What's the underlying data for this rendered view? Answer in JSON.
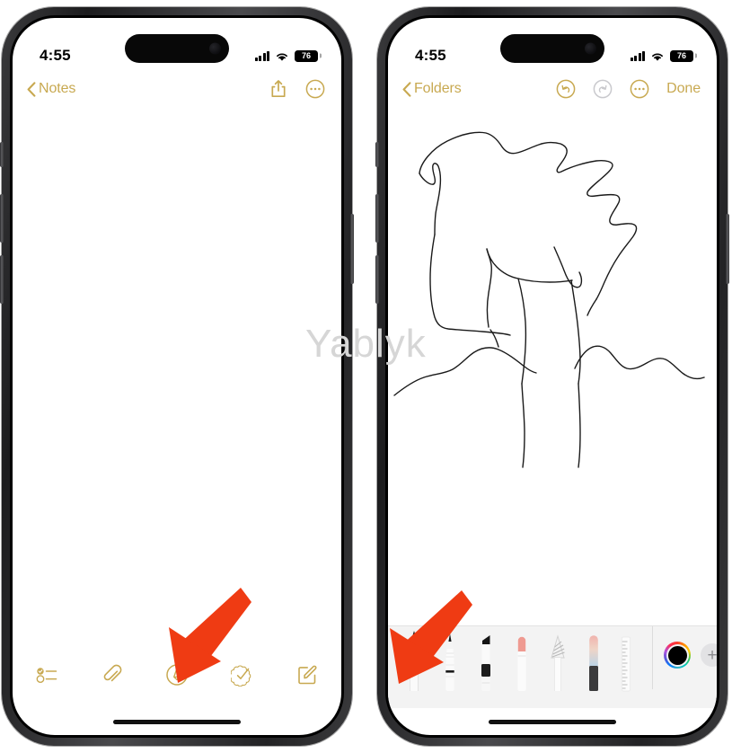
{
  "watermark": {
    "text": "Yablyk"
  },
  "phones": [
    {
      "id": "left",
      "status": {
        "time": "4:55",
        "battery": "76",
        "signal_icon": "cellular-bars-icon",
        "wifi_icon": "wifi-icon",
        "battery_icon": "battery-icon"
      },
      "navbar": {
        "back_label": "Notes",
        "back_icon": "chevron-left-icon",
        "share_icon": "share-icon",
        "more_icon": "more-circle-icon"
      },
      "toolbar": [
        {
          "name": "checklist-icon",
          "label": "Checklist"
        },
        {
          "name": "paperclip-icon",
          "label": "Attachment"
        },
        {
          "name": "markup-pen-circle-icon",
          "label": "Markup"
        },
        {
          "name": "scan-document-icon",
          "label": "Scan"
        },
        {
          "name": "compose-icon",
          "label": "New Note"
        }
      ],
      "annotation": {
        "arrow": "red-arrow-pointing-to-markup-button"
      }
    },
    {
      "id": "right",
      "status": {
        "time": "4:55",
        "battery": "76",
        "signal_icon": "cellular-bars-icon",
        "wifi_icon": "wifi-icon",
        "battery_icon": "battery-icon"
      },
      "navbar": {
        "back_label": "Folders",
        "back_icon": "chevron-left-icon",
        "undo_icon": "undo-circle-icon",
        "redo_icon": "redo-circle-icon",
        "more_icon": "more-circle-icon",
        "done_label": "Done"
      },
      "palette": {
        "tools": [
          {
            "name": "fountain-pen-tool",
            "label": "Pen"
          },
          {
            "name": "ink-pen-tool",
            "label": "Ink Pen"
          },
          {
            "name": "marker-tool",
            "label": "Marker"
          },
          {
            "name": "eraser-tool",
            "label": "Eraser"
          },
          {
            "name": "lasso-select-tool",
            "label": "Lasso"
          },
          {
            "name": "highlighter-tool",
            "label": "Highlighter"
          },
          {
            "name": "ruler-tool",
            "label": "Ruler"
          }
        ],
        "color_well": {
          "name": "color-picker",
          "selected_color": "#000000"
        },
        "add_button": {
          "name": "add-color-button",
          "label": "+"
        }
      },
      "annotation": {
        "arrow": "red-arrow-pointing-to-pen-tool"
      },
      "drawing": {
        "label": "hand-drawn-sketch"
      }
    }
  ],
  "colors": {
    "accent_gold": "#c8a951",
    "arrow_red": "#ef3b13",
    "palette_bg": "#f3f3f3",
    "disabled_gray": "#c9c9cd"
  }
}
